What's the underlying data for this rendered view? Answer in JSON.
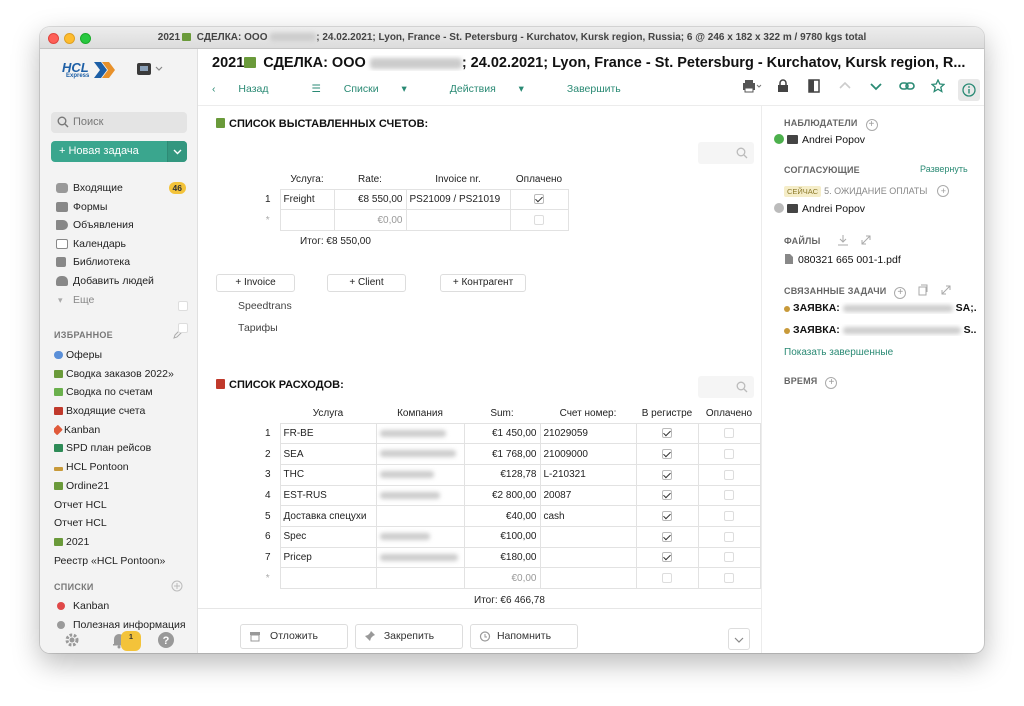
{
  "window_title": {
    "prefix": "2021",
    "deal": "СДЕЛКА: ООО",
    "rest": "; 24.02.2021; Lyon, France - St. Petersburg - Kurchatov, Kursk region, Russia; 6 @ 246 x 182 x 322 m / 9780 kgs total"
  },
  "sidebar": {
    "logo": {
      "text": "HCL",
      "sub": "Express"
    },
    "search_placeholder": "Поиск",
    "new_task": "Новая задача",
    "nav": [
      {
        "label": "Входящие",
        "badge": "46",
        "icon": "inbox-icon"
      },
      {
        "label": "Формы",
        "icon": "forms-icon"
      },
      {
        "label": "Объявления",
        "icon": "megaphone-icon"
      },
      {
        "label": "Календарь",
        "icon": "calendar-icon"
      },
      {
        "label": "Библиотека",
        "icon": "library-icon"
      },
      {
        "label": "Добавить людей",
        "icon": "add-people-icon"
      },
      {
        "label": "Еще",
        "icon": "chevron-down-icon"
      }
    ],
    "favorites_header": "ИЗБРАННОЕ",
    "favorites": [
      {
        "label": "Оферы",
        "color": "#5a8fd8"
      },
      {
        "label": "Сводка заказов 2022»",
        "color": "#6a9a3a"
      },
      {
        "label": "Сводка по счетам",
        "color": "#6ab04c"
      },
      {
        "label": "Входящие счета",
        "color": "#c0392b"
      },
      {
        "label": "Kanban",
        "color": "#e05a3a"
      },
      {
        "label": "SPD план рейсов",
        "color": "#2e8b57"
      },
      {
        "label": "HCL Pontoon",
        "color": "#c89a3a"
      },
      {
        "label": "Ordine21",
        "color": "#6a9a3a"
      },
      {
        "label": "Отчет HCL",
        "color": "#c0392b"
      },
      {
        "label": "Отчет HCL",
        "color": "#6a9a3a"
      },
      {
        "label": "2021",
        "color": "#6a9a3a"
      },
      {
        "label": "Реестр «HCL Pontoon»",
        "color": "#c89a3a"
      }
    ],
    "lists_header": "СПИСКИ",
    "lists": [
      {
        "label": "Kanban",
        "color": "#e04848"
      },
      {
        "label": "Полезная информация",
        "color": "#9a9a9a"
      }
    ],
    "bell_badge": "1"
  },
  "header": {
    "title_prefix": "2021",
    "title_deal": "СДЕЛКА: ООО",
    "title_rest": "; 24.02.2021; Lyon, France - St. Petersburg - Kurchatov, Kursk region, R...",
    "back": "Назад",
    "lists": "Списки",
    "actions": "Действия",
    "finish": "Завершить"
  },
  "invoices": {
    "title": "СПИСОК ВЫСТАВЛЕННЫХ СЧЕТОВ:",
    "columns": [
      "Услуга:",
      "Rate:",
      "Invoice nr.",
      "Оплачено"
    ],
    "rows": [
      {
        "idx": "1",
        "service": "Freight",
        "rate": "€8 550,00",
        "invoice": "PS21009 / PS21019",
        "paid": true
      },
      {
        "idx": "*",
        "service": "",
        "rate": "€0,00",
        "invoice": "",
        "paid": false
      }
    ],
    "total": "Итог: €8 550,00",
    "buttons": [
      "+ Invoice",
      "+ Client",
      "+ Контрагент"
    ],
    "checkboxes": [
      "Speedtrans",
      "Тарифы"
    ]
  },
  "expenses": {
    "title": "СПИСОК РАСХОДОВ:",
    "columns": [
      "Услуга",
      "Компания",
      "Sum:",
      "Счет номер:",
      "В регистре",
      "Оплачено"
    ],
    "rows": [
      {
        "idx": "1",
        "service": "FR-BE",
        "sum": "€1 450,00",
        "number": "21029059",
        "reg": true,
        "paid": false
      },
      {
        "idx": "2",
        "service": "SEA",
        "sum": "€1 768,00",
        "number": "21009000",
        "reg": true,
        "paid": false
      },
      {
        "idx": "3",
        "service": "THC",
        "sum": "€128,78",
        "number": "L-210321",
        "reg": true,
        "paid": false
      },
      {
        "idx": "4",
        "service": "EST-RUS",
        "sum": "€2 800,00",
        "number": "20087",
        "reg": true,
        "paid": false
      },
      {
        "idx": "5",
        "service": "Доставка спецухи",
        "sum": "€40,00",
        "number": "cash",
        "reg": true,
        "paid": false
      },
      {
        "idx": "6",
        "service": "Spec",
        "sum": "€100,00",
        "number": "",
        "reg": true,
        "paid": false
      },
      {
        "idx": "7",
        "service": "Pricep",
        "sum": "€180,00",
        "number": "",
        "reg": true,
        "paid": false
      },
      {
        "idx": "*",
        "service": "",
        "sum": "€0,00",
        "number": "",
        "reg": false,
        "paid": false
      }
    ],
    "total": "Итог: €6 466,78"
  },
  "footer": {
    "postpone": "Отложить",
    "pin": "Закрепить",
    "remind": "Напомнить"
  },
  "right": {
    "watchers": "НАБЛЮДАТЕЛИ",
    "watcher_name": "Andrei Popov",
    "approvers": "СОГЛАСУЮЩИЕ",
    "expand": "Развернуть",
    "now_label": "СЕЙЧАС",
    "stage": "5. ОЖИДАНИЕ ОПЛАТЫ",
    "approver_name": "Andrei Popov",
    "files": "ФАЙЛЫ",
    "file_name": "080321 665 001-1.pdf",
    "related": "СВЯЗАННЫЕ ЗАДАЧИ",
    "rel1_prefix": "ЗАЯВКА:",
    "rel1_suffix": "SA;...",
    "rel2_prefix": "ЗАЯВКА:",
    "rel2_suffix": "S...",
    "show_finished": "Показать завершенные",
    "time": "ВРЕМЯ"
  },
  "colors": {
    "accent": "#3aa68e",
    "link": "#2a8a74",
    "badge": "#f3c33a"
  }
}
